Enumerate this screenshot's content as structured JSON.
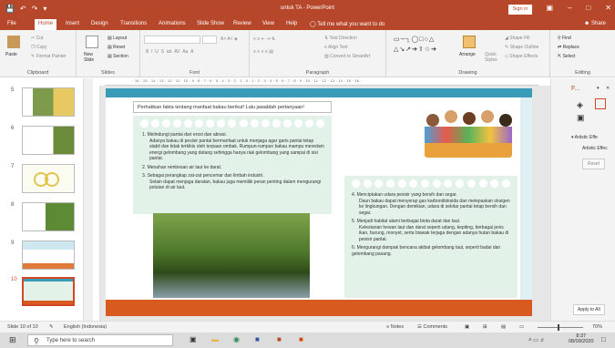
{
  "window": {
    "title": "untuk TA  -  PowerPoint",
    "sign_in": "Sign in",
    "colors": {
      "accent": "#b7472a",
      "slide_orange": "#d85a1f",
      "slide_teal": "#3a9bb9",
      "card_green": "#e3f2e9"
    }
  },
  "ribbon_tabs": [
    "File",
    "Home",
    "Insert",
    "Design",
    "Transitions",
    "Animations",
    "Slide Show",
    "Review",
    "View",
    "Help"
  ],
  "tell_me": "Tell me what you want to do",
  "share": "Share",
  "ribbon": {
    "clipboard": {
      "paste": "Paste",
      "cut": "Cut",
      "copy": "Copy",
      "format_painter": "Format Painter",
      "label": "Clipboard"
    },
    "slides": {
      "new_slide": "New Slide",
      "layout": "Layout",
      "reset": "Reset",
      "section": "Section",
      "label": "Slides"
    },
    "font": {
      "label": "Font"
    },
    "paragraph": {
      "text_direction": "Text Direction",
      "align_text": "Align Text",
      "smartart": "Convert to SmartArt",
      "label": "Paragraph"
    },
    "drawing": {
      "arrange": "Arrange",
      "quick_styles": "Quick Styles",
      "shape_fill": "Shape Fill",
      "shape_outline": "Shape Outline",
      "shape_effects": "Shape Effects",
      "label": "Drawing"
    },
    "editing": {
      "find": "Find",
      "replace": "Replace",
      "select": "Select",
      "label": "Editing"
    }
  },
  "ruler_text": "· 16 · 15 · 14 · 13 · 12 · 11 · 10 · 9 · 8 · 7 · 6 · 5 · 4 · 3 · 2 · 1 · 0 · 1 · 2 · 3 · 4 · 5 · 6 · 7 · 8 · 9 · 10 · 11 · 12 · 13 · 14 · 15 · 16 ·",
  "thumbnails": [
    "5",
    "6",
    "7",
    "8",
    "9",
    "10"
  ],
  "slide": {
    "instruction": "Perhatikan fakta tentang manfaat bakau berikut! Lalu jawablah pertanyaan!",
    "left_items": [
      {
        "num": "1.",
        "head": "Melindungi pantai dari erosi dan abrasi.",
        "body": "Adanya bakau di pesisir pantai bermanfaat untuk menjaga agar garis pantai tetap stabil dan tidak terkikis oleh terpaan ombak. Rumpun-rumpun bakau mampu meredam energi gelombang yang datang sehingga hanya riak gelombang yang sampai di sisi pantai."
      },
      {
        "num": "2.",
        "head": "Menahan rembesan air laut ke darat.",
        "body": ""
      },
      {
        "num": "3.",
        "head": "Sebagai perangkap zat-zat pencemar dan limbah industri.",
        "body": "Selain dapat menjaga daratan, bakau juga memiliki peran penting dalam mengurangi polutan di air laut."
      }
    ],
    "right_items": [
      {
        "num": "4.",
        "head": "Menciptakan udara pesisir yang bersih dan segar.",
        "body": "Daun bakau dapat menyerap gas karbondioksida dan melepaskan oksigen ke lingkungan. Dengan demikian, udara di sekitar pantai tetap bersih dan segar."
      },
      {
        "num": "5.",
        "head": "Menjadi habitat alami berbagai biota darat dan laut.",
        "body": "Kelestarian hewan laut dan darat seperti udang, kepiting, berbagai jenis ikan, burung, monyet, serta biawak terjaga dengan adanya hutan bakau di pesisir pantai."
      },
      {
        "num": "6.",
        "head": "Mengurangi dampak bencana akibat gelombang laut, seperti badai dan gelombang pasang.",
        "body": ""
      }
    ]
  },
  "right_pane": {
    "title": "F...",
    "artistic_effects": "Artistic Effe",
    "artistic_effects_sub": "Artistic Effec",
    "reset": "Reset",
    "apply_all": "Apply to All"
  },
  "status": {
    "slide_of": "Slide 10 of 10",
    "language": "English (Indonesia)",
    "notes": "Notes",
    "comments": "Comments",
    "zoom": "70%"
  },
  "taskbar": {
    "search_placeholder": "Type here to search",
    "time": "8:37",
    "date": "08/09/2020"
  }
}
